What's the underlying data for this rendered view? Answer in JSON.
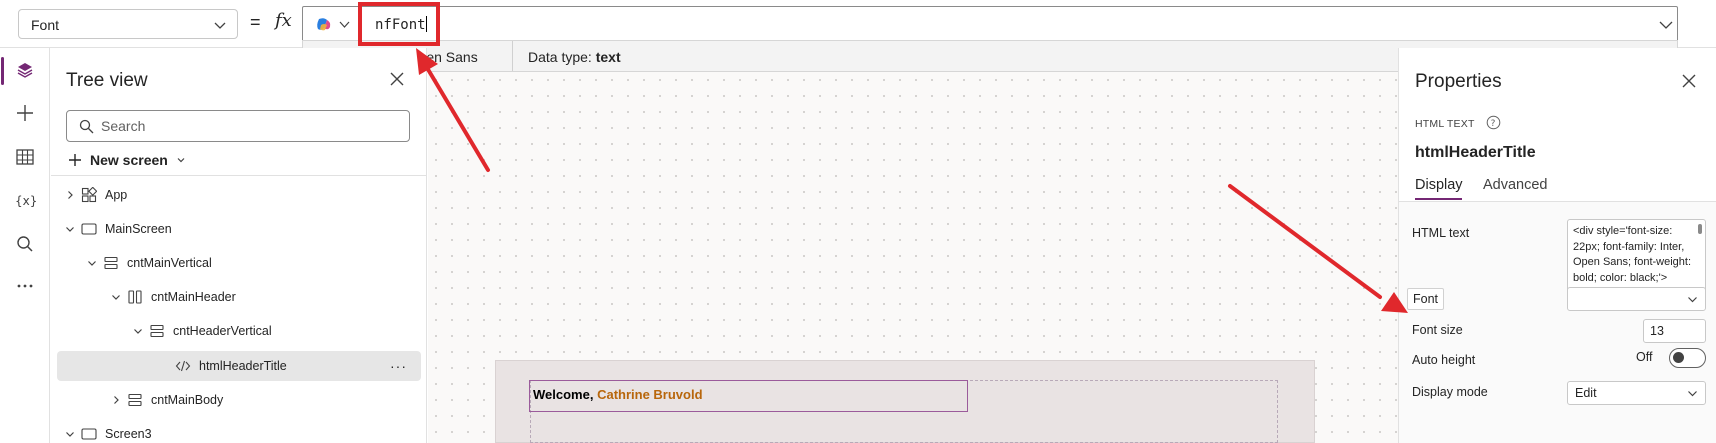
{
  "formula_bar": {
    "property": "Font",
    "equals": "=",
    "fx": "fx",
    "formula": "nfFont"
  },
  "intellisense": {
    "signature": "nfFont  =  Inter, Open Sans",
    "data_type_label": "Data type:",
    "data_type_value": "text"
  },
  "left_rail": {
    "items": [
      "tree-view-icon",
      "insert-icon",
      "data-icon",
      "variables-icon",
      "search-icon",
      "more-icon"
    ]
  },
  "tree_view": {
    "title": "Tree view",
    "search_placeholder": "Search",
    "new_screen_label": "New screen",
    "items": [
      {
        "label": "App",
        "icon": "app-icon",
        "expanded": false
      },
      {
        "label": "MainScreen",
        "icon": "screen-icon",
        "expanded": true
      },
      {
        "label": "cntMainVertical",
        "icon": "vertical-container-icon",
        "expanded": true
      },
      {
        "label": "cntMainHeader",
        "icon": "horizontal-container-icon",
        "expanded": true
      },
      {
        "label": "cntHeaderVertical",
        "icon": "vertical-container-icon",
        "expanded": true
      },
      {
        "label": "htmlHeaderTitle",
        "icon": "html-icon",
        "selected": true
      },
      {
        "label": "cntMainBody",
        "icon": "vertical-container-icon",
        "expanded": false
      },
      {
        "label": "Screen3",
        "icon": "screen-icon",
        "expanded": true
      }
    ],
    "more_label": "···"
  },
  "canvas": {
    "welcome_prefix": "Welcome,",
    "user_name": "Cathrine Bruvold"
  },
  "properties": {
    "title": "Properties",
    "control_type": "HTML TEXT",
    "control_name": "htmlHeaderTitle",
    "tabs": [
      {
        "label": "Display",
        "active": true
      },
      {
        "label": "Advanced",
        "active": false
      }
    ],
    "rows": {
      "html_text_label": "HTML text",
      "html_text_value": "<div style='font-size: 22px; font-family: Inter, Open Sans; font-weight: bold; color: black;'>",
      "font_label": "Font",
      "font_value": "",
      "font_size_label": "Font size",
      "font_size_value": "13",
      "auto_height_label": "Auto height",
      "auto_height_state": "Off",
      "display_mode_label": "Display mode",
      "display_mode_value": "Edit"
    }
  },
  "colors": {
    "accent": "#742774",
    "annotation_red": "#e0282c",
    "user_name": "#b8660b"
  }
}
